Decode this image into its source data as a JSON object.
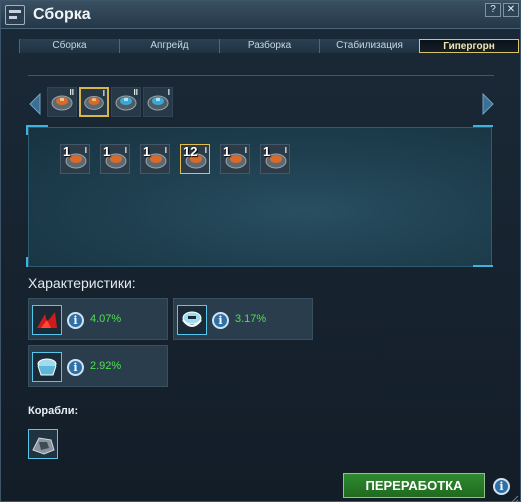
{
  "window": {
    "title": "Сборка",
    "help_label": "?",
    "close_label": "✕"
  },
  "tabs": [
    {
      "label": "Сборка",
      "active": false
    },
    {
      "label": "Апгрейд",
      "active": false
    },
    {
      "label": "Разборка",
      "active": false
    },
    {
      "label": "Стабилизация",
      "active": false
    },
    {
      "label": "Гипергорн",
      "active": true
    }
  ],
  "categories": [
    {
      "icon": "orange-module-icon",
      "tier": "II",
      "selected": false
    },
    {
      "icon": "orange-module-icon",
      "tier": "I",
      "selected": true
    },
    {
      "icon": "blue-module-icon",
      "tier": "II",
      "selected": false
    },
    {
      "icon": "blue-module-icon",
      "tier": "I",
      "selected": false
    }
  ],
  "modules": [
    {
      "count": "1",
      "tier": "I",
      "selected": false
    },
    {
      "count": "1",
      "tier": "I",
      "selected": false
    },
    {
      "count": "1",
      "tier": "I",
      "selected": false
    },
    {
      "count": "12",
      "tier": "I",
      "selected": true
    },
    {
      "count": "1",
      "tier": "I",
      "selected": false
    },
    {
      "count": "1",
      "tier": "I",
      "selected": false
    }
  ],
  "characteristics": {
    "title": "Характеристики:",
    "stats": [
      {
        "icon": "red-damage-icon",
        "value": "4.07%"
      },
      {
        "icon": "shield-stat-icon",
        "value": "3.17%"
      },
      {
        "icon": "hull-stat-icon",
        "value": "2.92%"
      }
    ],
    "info_label": "i"
  },
  "ships": {
    "title": "Корабли:",
    "items": [
      {
        "icon": "ship-icon"
      }
    ]
  },
  "actions": {
    "process_label": "ПЕРЕРАБОТКА",
    "info_label": "i"
  },
  "colors": {
    "accent": "#3fb3df",
    "selected": "#d8b64a",
    "positive": "#4fe04f",
    "action": "#2f8a2f"
  }
}
